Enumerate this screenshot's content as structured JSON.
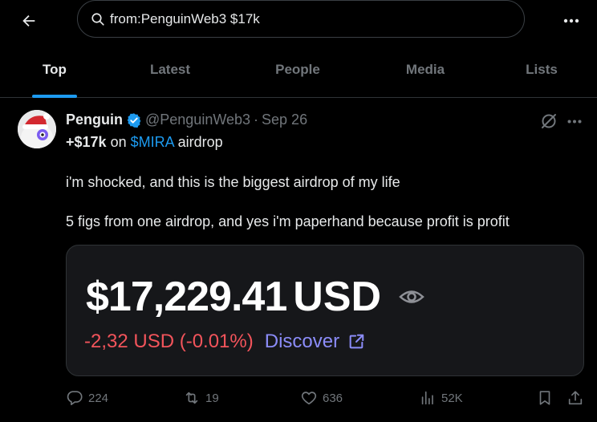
{
  "search": {
    "query": "from:PenguinWeb3 $17k"
  },
  "tabs": [
    {
      "label": "Top",
      "active": true
    },
    {
      "label": "Latest",
      "active": false
    },
    {
      "label": "People",
      "active": false
    },
    {
      "label": "Media",
      "active": false
    },
    {
      "label": "Lists",
      "active": false
    }
  ],
  "tweet": {
    "name": "Penguin",
    "handle": "@PenguinWeb3",
    "separator": "·",
    "date": "Sep 26",
    "line1": {
      "amount": "+$17k",
      "pre": " on ",
      "cashtag": "$MIRA",
      "post": " airdrop"
    },
    "line2": "i'm shocked, and this is the biggest airdrop of my life",
    "line3": "5 figs from one airdrop, and yes i'm paperhand because profit is profit",
    "card": {
      "amount": "$17,229.41",
      "currency": "USD",
      "change": "-2,32 USD (-0.01%)",
      "discover": "Discover"
    },
    "actions": {
      "replies": "224",
      "reposts": "19",
      "likes": "636",
      "views": "52K"
    }
  },
  "colors": {
    "accent": "#1d9bf0",
    "negative": "#f2545b",
    "discover": "#8b8cf8",
    "muted": "#71767b"
  }
}
